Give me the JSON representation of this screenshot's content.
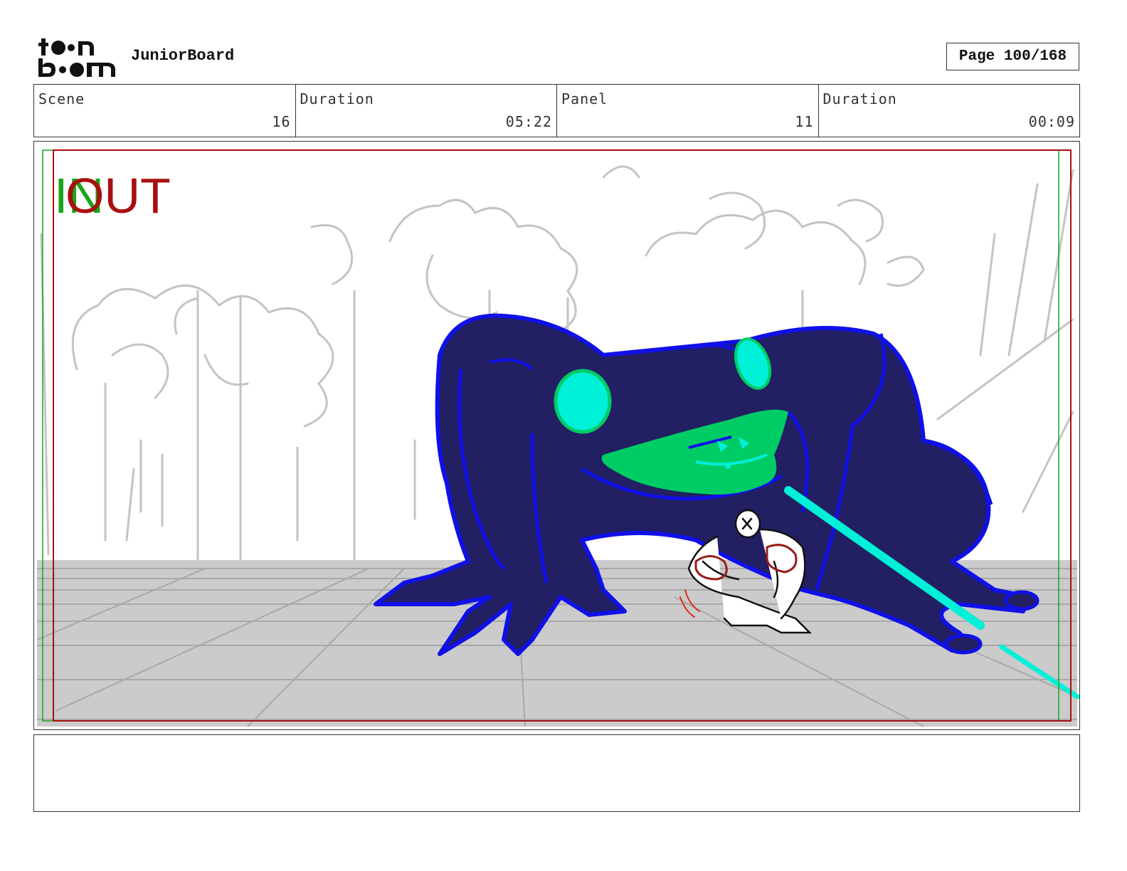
{
  "header": {
    "logo_text": "toon boom",
    "app_name": "JuniorBoard",
    "page_label": "Page 100/168"
  },
  "info": {
    "scene": {
      "label": "Scene",
      "value": "16"
    },
    "scene_duration": {
      "label": "Duration",
      "value": "05:22"
    },
    "panel": {
      "label": "Panel",
      "value": "11"
    },
    "panel_duration": {
      "label": "Duration",
      "value": "00:09"
    }
  },
  "frame": {
    "in_label": "IN",
    "out_label": "OUT"
  },
  "colors": {
    "frog_body": "#221f63",
    "frog_outline": "#1010e8",
    "frog_mouth": "#00cc66",
    "frog_eyes": "#00f0d8",
    "floor": "#cbcbcb",
    "in_marker": "#19a619",
    "out_marker": "#a80f0f"
  },
  "notes": {
    "text": ""
  }
}
